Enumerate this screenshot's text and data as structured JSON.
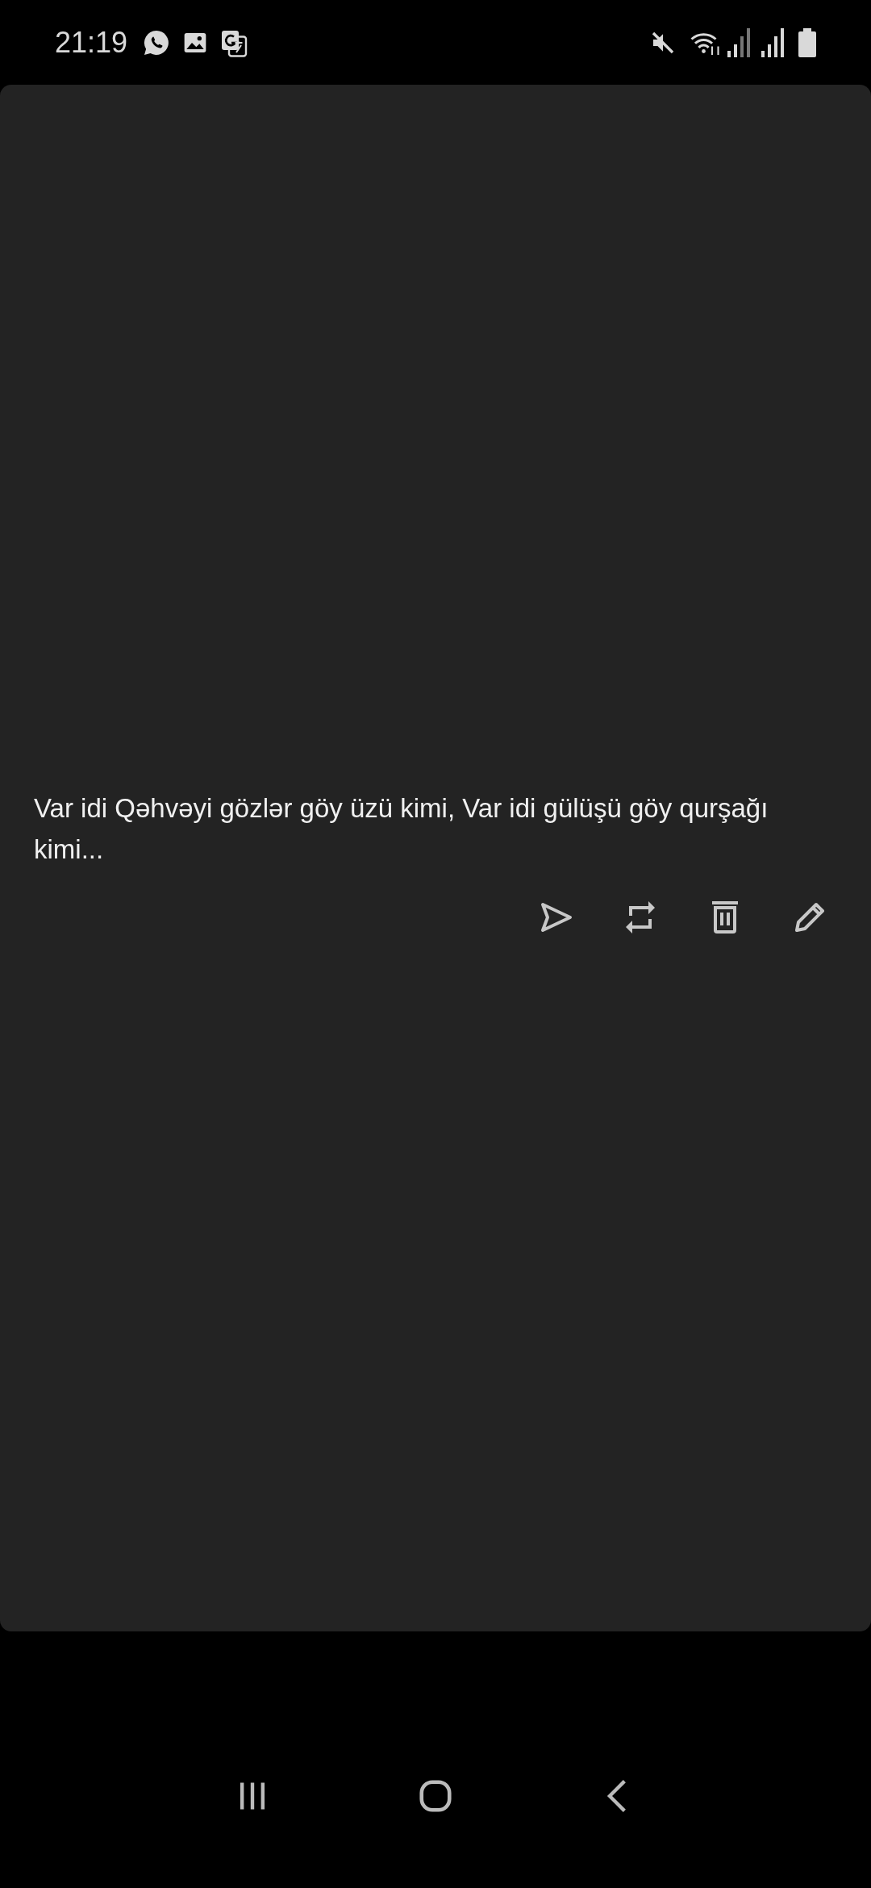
{
  "status_bar": {
    "time": "21:19"
  },
  "note": {
    "text": "Var idi Qəhvəyi gözlər göy üzü kimi, Var idi gülüşü göy qurşağı kimi..."
  }
}
